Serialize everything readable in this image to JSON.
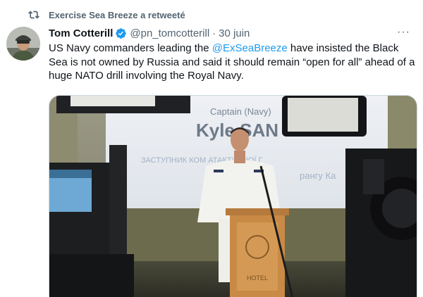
{
  "social_context": {
    "icon": "retweet-icon",
    "text": "Exercise Sea Breeze a retweeté"
  },
  "tweet": {
    "avatar_icon": "avatar-photo",
    "display_name": "Tom Cotterill",
    "verified_icon": "verified-badge-icon",
    "handle": "@pn_tomcotterill",
    "separator": "·",
    "date": "30 juin",
    "more_label": "···",
    "text_before": "US Navy commanders leading the ",
    "mention": "@ExSeaBreeze",
    "text_after": " have insisted the Black Sea is not owned by Russia and said it should remain “open for all” ahead of a huge NATO drill involving the Royal Navy."
  },
  "media": {
    "screen_title": "Captain (Navy)",
    "screen_name": "Kyle SAN",
    "screen_subtitle": "ЗАСТУПНИК КОМ     АТАКТИЧНОЇ Г",
    "screen_subtitle2": "рангу Ка",
    "podium_text": "HOTEL"
  },
  "colors": {
    "accent": "#1d9bf0",
    "secondary_text": "#536471",
    "primary_text": "#0f1419",
    "border": "#cfd9de"
  }
}
